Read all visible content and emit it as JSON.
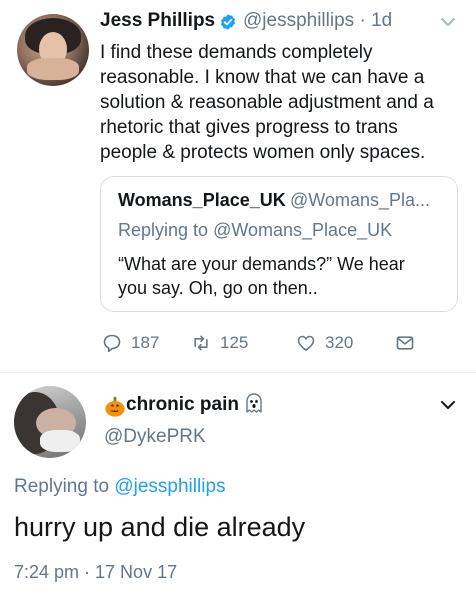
{
  "tweet": {
    "author_name": "Jess Phillips",
    "author_handle": "@jessphillips",
    "time_ago": "1d",
    "text_lines": [
      "I find these demands completely",
      "reasonable. I know that we can have a",
      "solution & reasonable adjustment and a",
      "rhetoric that gives progress to trans",
      "people & protects women only spaces."
    ],
    "quoted": {
      "author_name": "Womans_Place_UK",
      "author_handle": "@Womans_Pla...",
      "replying_to_label": "Replying to",
      "replying_to_handle": "@Womans_Place_UK",
      "text_lines": [
        "“What are your demands?” We hear",
        "you say.  Oh, go on then.."
      ]
    },
    "actions": {
      "reply_count": "187",
      "retweet_count": "125",
      "like_count": "320"
    }
  },
  "reply": {
    "author_name": "chronic pain",
    "author_handle": "@DykePRK",
    "replying_to_label": "Replying to",
    "replying_to_handle": "@jessphillips",
    "text": "hurry up and die already",
    "timestamp": "7:24 pm · 17 Nov 17"
  },
  "colors": {
    "text": "#14171a",
    "muted": "#657786",
    "link": "#1da1f2",
    "verified": "#1da1f2",
    "pumpkin": "#f4900c"
  },
  "icons": {
    "verified": "verified-badge-icon",
    "reply": "reply-icon",
    "retweet": "retweet-icon",
    "like": "heart-icon",
    "dm": "envelope-icon",
    "caret": "chevron-down-icon",
    "pumpkin": "jack-o-lantern-icon",
    "ghost": "ghost-icon"
  }
}
